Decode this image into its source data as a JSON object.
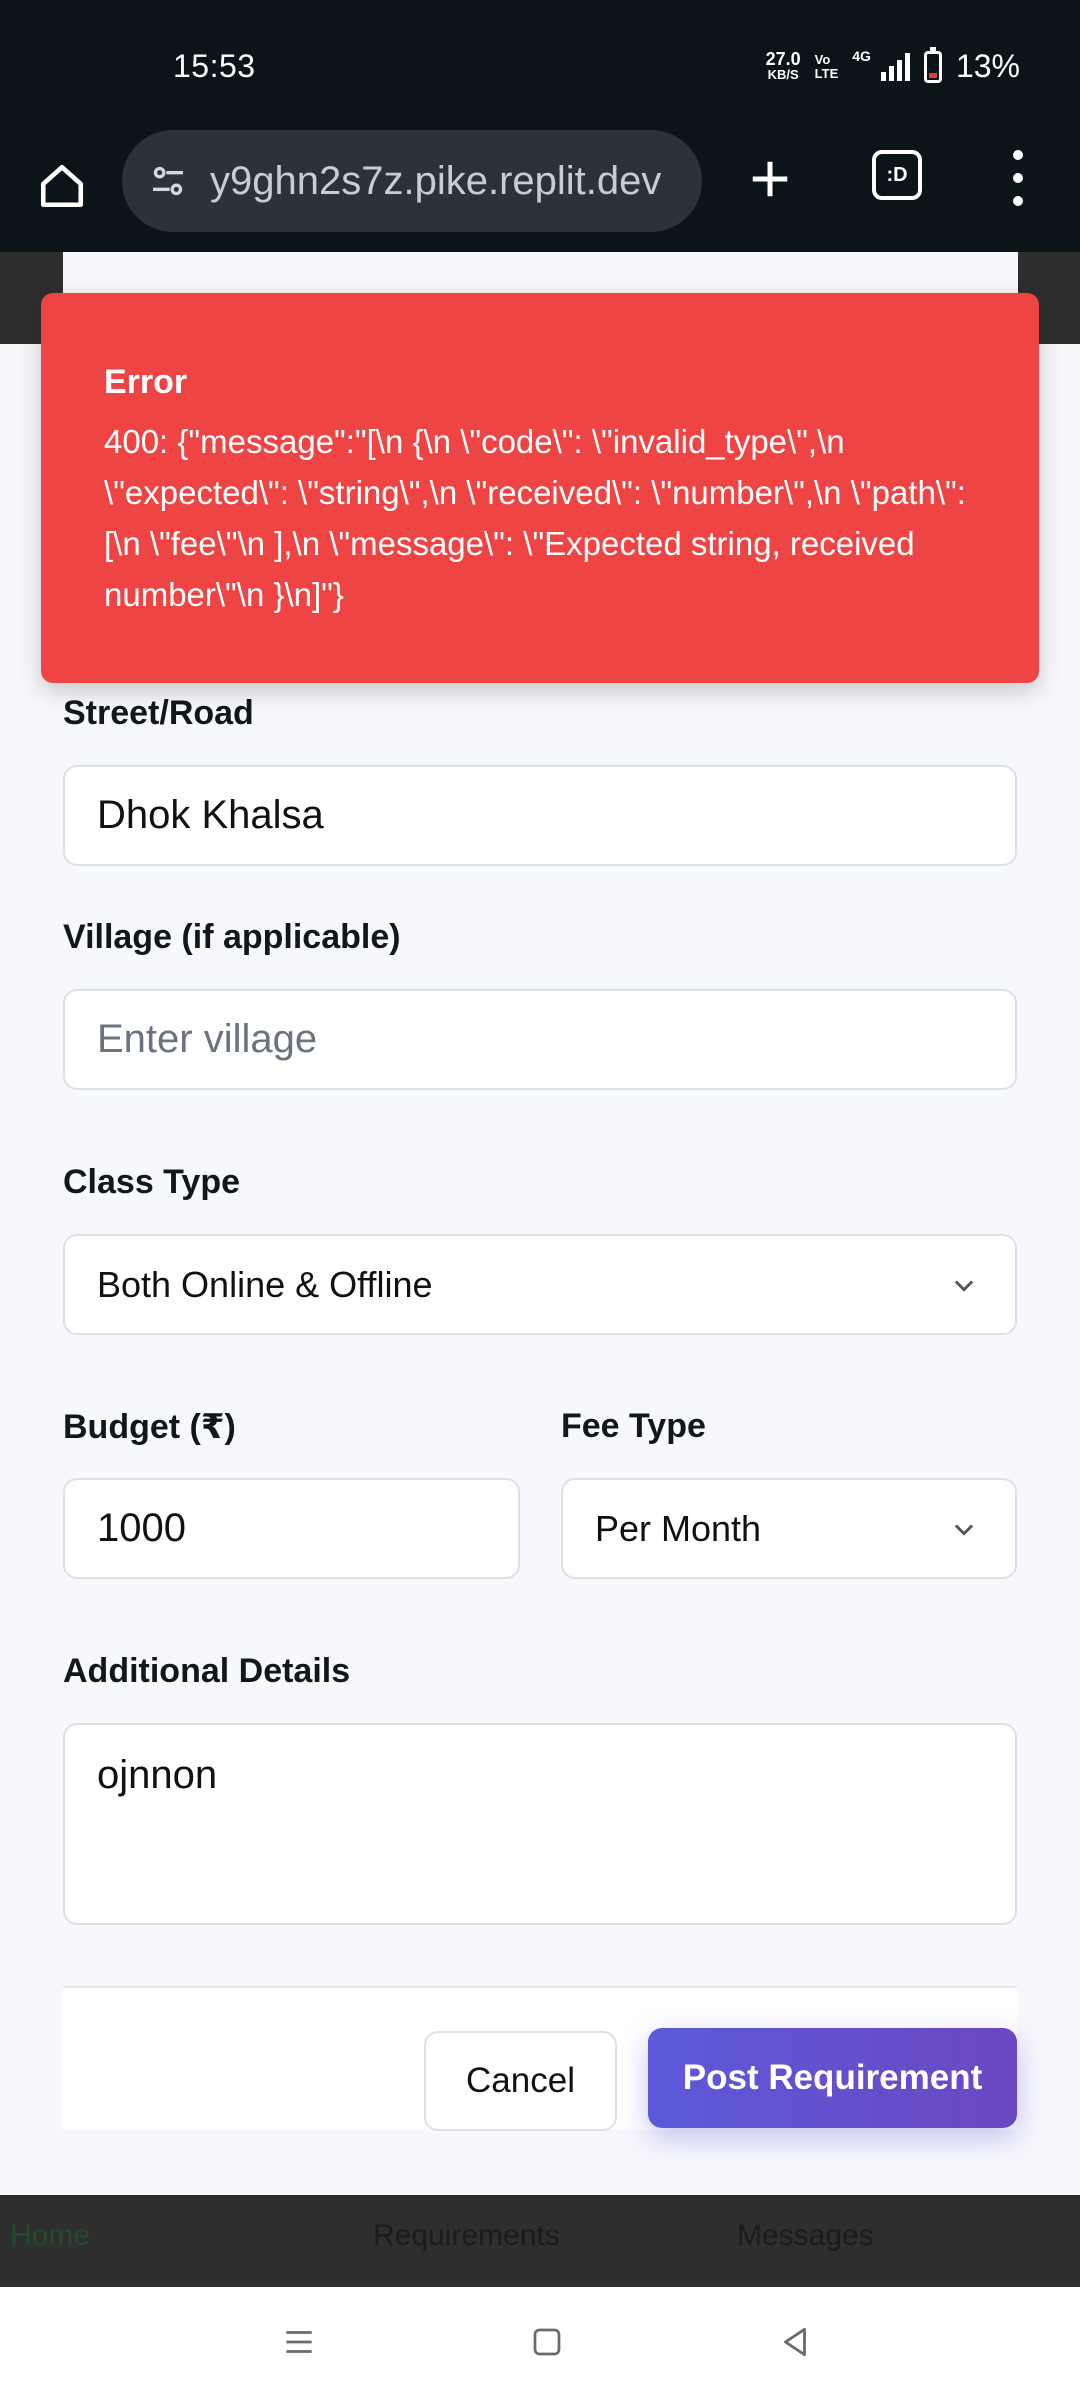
{
  "status_bar": {
    "time": "15:53",
    "net_speed_value": "27.0",
    "net_speed_unit": "KB/S",
    "volte_top": "Vo",
    "volte_bottom": "LTE",
    "network_type": "4G",
    "battery": "13%"
  },
  "browser": {
    "url": "y9ghn2s7z.pike.replit.dev",
    "tabs_label": ":D"
  },
  "toast": {
    "title": "Error",
    "message": "400: {\"message\":\"[\\n {\\n \\\"code\\\": \\\"invalid_type\\\",\\n \\\"expected\\\": \\\"string\\\",\\n \\\"received\\\": \\\"number\\\",\\n \\\"path\\\": [\\n \\\"fee\\\"\\n ],\\n \\\"message\\\": \\\"Expected string, received number\\\"\\n }\\n]\"}"
  },
  "form": {
    "street": {
      "label": "Street/Road",
      "value": "Dhok Khalsa"
    },
    "village": {
      "label": "Village (if applicable)",
      "placeholder": "Enter village"
    },
    "class_type": {
      "label": "Class Type",
      "selected": "Both Online & Offline"
    },
    "budget": {
      "label": "Budget (₹)",
      "value": "1000"
    },
    "fee_type": {
      "label": "Fee Type",
      "selected": "Per Month"
    },
    "details": {
      "label": "Additional Details",
      "value": "ojnnon"
    },
    "cancel_label": "Cancel",
    "submit_label": "Post Requirement"
  },
  "app_nav": {
    "items": [
      {
        "label": "Home"
      },
      {
        "label": "Requirements"
      },
      {
        "label": "Messages"
      }
    ]
  },
  "colors": {
    "error": "#ef4444",
    "primary": "#5b5ad9",
    "status_bg": "#0b1419"
  }
}
